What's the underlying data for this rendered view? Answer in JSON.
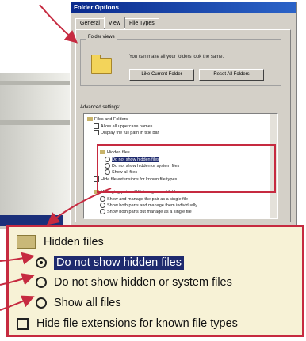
{
  "dialog": {
    "title": "Folder Options",
    "tabs": [
      {
        "label": "General"
      },
      {
        "label": "View"
      },
      {
        "label": "File Types"
      }
    ],
    "folder_views": {
      "title": "Folder views",
      "description": "You can make all your folders look the same.",
      "like_current_label": "Like Current Folder",
      "reset_all_label": "Reset All Folders"
    },
    "advanced_title": "Advanced settings:",
    "advanced_items": [
      {
        "label": "Files and Folders"
      },
      {
        "label": "Allow all uppercase names"
      },
      {
        "label": "Display the full path in title bar"
      },
      {
        "label": "Hidden files"
      },
      {
        "label": "Do not show hidden files"
      },
      {
        "label": "Do not show hidden or system files"
      },
      {
        "label": "Show all files"
      },
      {
        "label": "Hide file extensions for known file types"
      },
      {
        "label": "Managing pairs of Web pages and folders"
      },
      {
        "label": "Show and manage the pair as a single file"
      },
      {
        "label": "Show both parts and manage them individually"
      },
      {
        "label": "Show both parts but manage as a single file"
      }
    ]
  },
  "zoom": {
    "group_label": "Hidden files",
    "options": [
      {
        "label": "Do not show hidden files"
      },
      {
        "label": "Do not show hidden or system files"
      },
      {
        "label": "Show all files"
      }
    ],
    "checkbox_label": "Hide file extensions for known file types"
  },
  "colors": {
    "highlight": "#c62a40",
    "selection": "#1e2a6e",
    "callout_bg": "#f7f2d6"
  }
}
